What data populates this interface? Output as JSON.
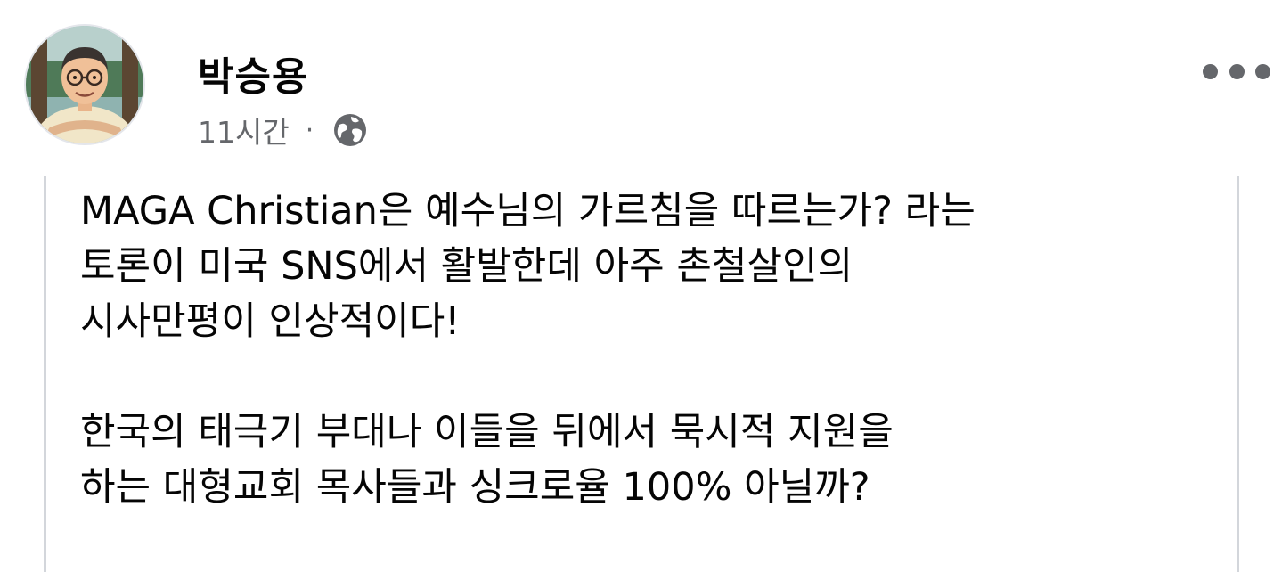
{
  "post": {
    "author": {
      "name": "박승용",
      "avatar_icon": "avatar-illustration"
    },
    "meta": {
      "time": "11시간",
      "separator": "·",
      "privacy_icon": "globe-icon"
    },
    "more_icon": "more-horizontal-icon",
    "body": {
      "paragraph_1": [
        "MAGA Christian은 예수님의 가르침을 따르는가? 라는",
        "토론이 미국 SNS에서 활발한데 아주 촌철살인의",
        "시사만평이 인상적이다!"
      ],
      "paragraph_2": [
        "한국의 태극기 부대나 이들을 뒤에서 묵시적 지원을",
        "하는 대형교회 목사들과 싱크로율 100% 아닐까?"
      ]
    }
  },
  "colors": {
    "text": "#050505",
    "secondary_text": "#65676b",
    "divider": "#d3d6db",
    "background": "#ffffff"
  }
}
